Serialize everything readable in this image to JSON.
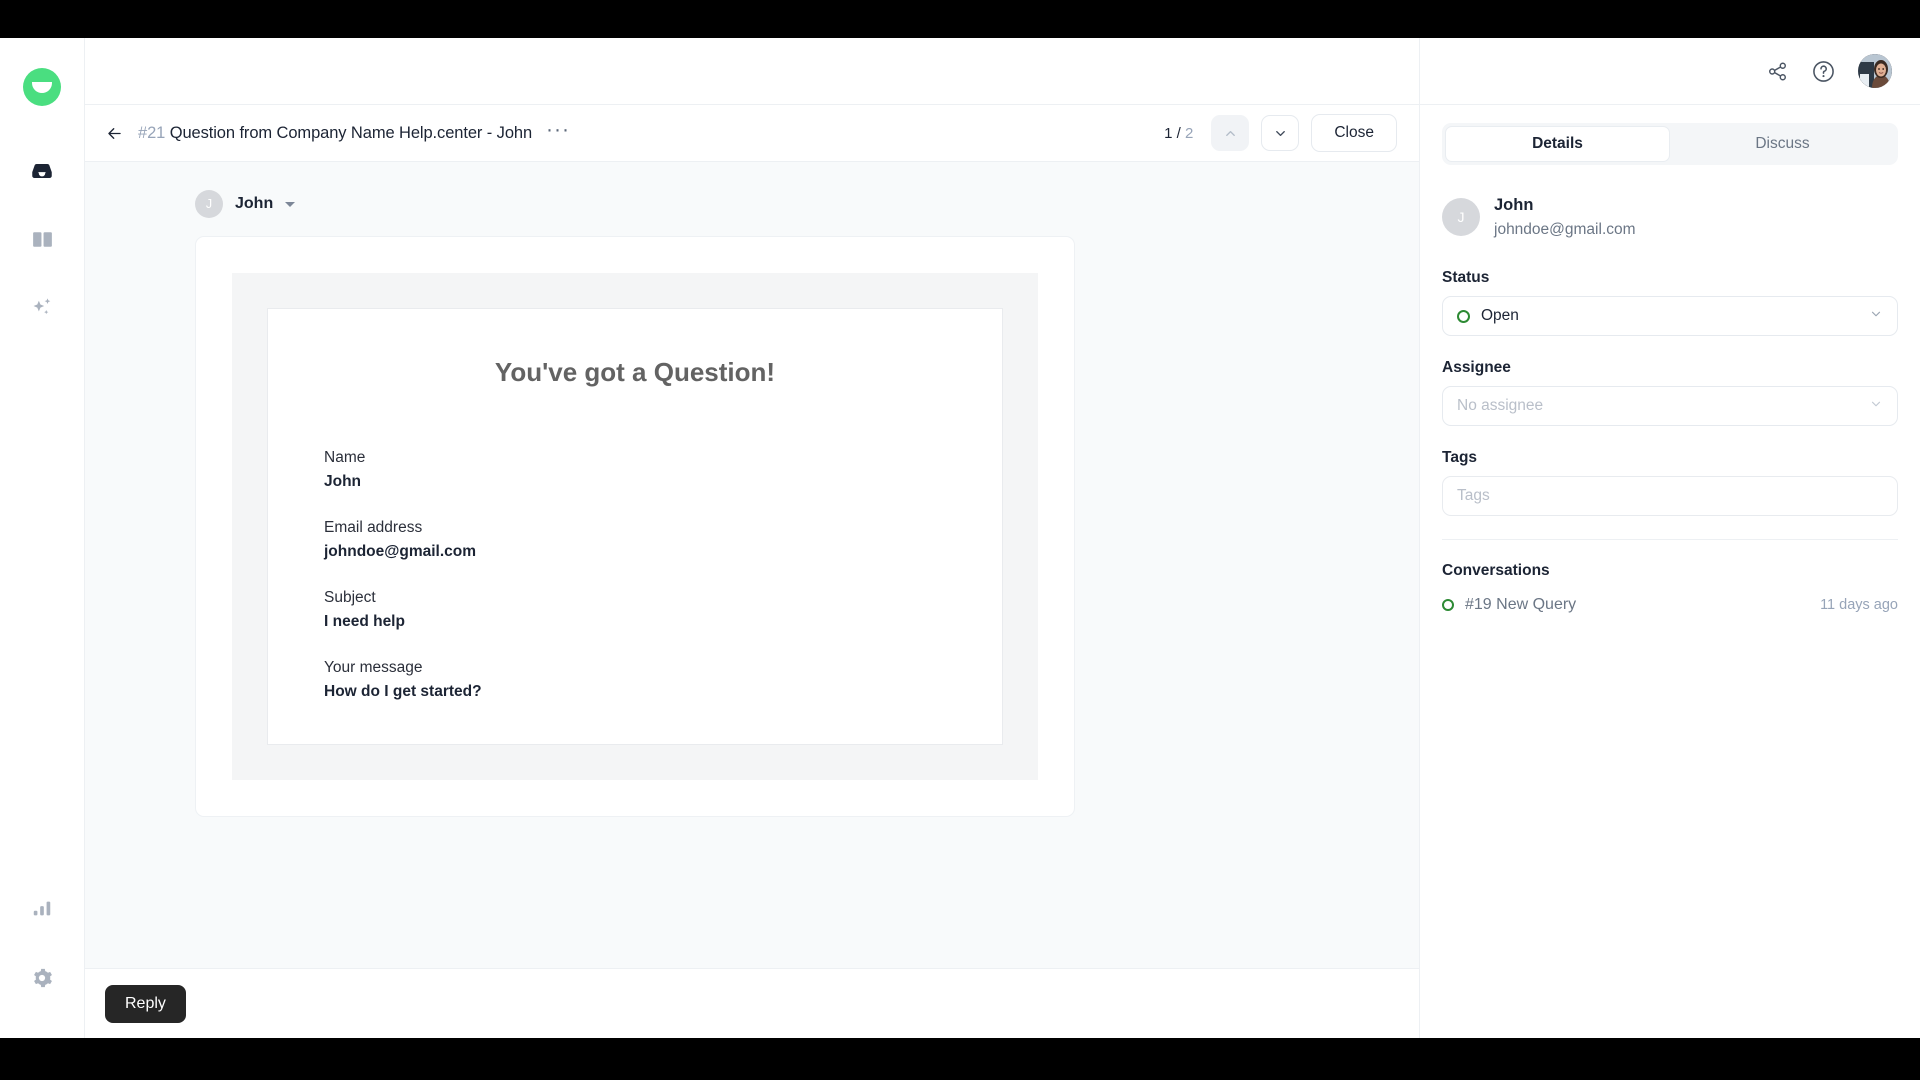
{
  "brand": {
    "logo_name": "helpcenter-logo",
    "accent": "#4ade80"
  },
  "rail": {
    "items": [
      {
        "name": "inbox",
        "icon": "inbox-icon",
        "active": true
      },
      {
        "name": "knowledge-base",
        "icon": "book-icon",
        "active": false
      },
      {
        "name": "ai-assist",
        "icon": "sparkles-icon",
        "active": false
      }
    ],
    "bottom_items": [
      {
        "name": "reports",
        "icon": "bar-chart-icon"
      },
      {
        "name": "settings",
        "icon": "gear-icon"
      }
    ]
  },
  "topbar": {
    "share_icon": "share-icon",
    "help_icon": "question-circle-icon",
    "avatar_name": "user-avatar"
  },
  "conversation": {
    "back_icon": "arrow-left-icon",
    "number": "#21",
    "title": "Question from Company Name Help.center - John",
    "more_label": "···",
    "page_current": "1",
    "page_separator": "/",
    "page_total": "2",
    "prev_icon": "chevron-up-icon",
    "next_icon": "chevron-down-icon",
    "close_label": "Close"
  },
  "message": {
    "author_initial": "J",
    "author": "John",
    "email_card": {
      "title": "You've got a Question!",
      "fields": [
        {
          "label": "Name",
          "value": "John"
        },
        {
          "label": "Email address",
          "value": "johndoe@gmail.com"
        },
        {
          "label": "Subject",
          "value": "I need help"
        },
        {
          "label": "Your message",
          "value": "How do I get started?"
        }
      ]
    }
  },
  "footer": {
    "reply_label": "Reply"
  },
  "details": {
    "tabs": [
      {
        "label": "Details",
        "active": true
      },
      {
        "label": "Discuss",
        "active": false
      }
    ],
    "contact": {
      "initial": "J",
      "name": "John",
      "email": "johndoe@gmail.com"
    },
    "status": {
      "label": "Status",
      "value": "Open",
      "color": "#2d8a34"
    },
    "assignee": {
      "label": "Assignee",
      "placeholder": "No assignee"
    },
    "tags": {
      "label": "Tags",
      "placeholder": "Tags",
      "value": ""
    },
    "conversations": {
      "label": "Conversations",
      "items": [
        {
          "id": "#19",
          "title": "#19 New Query",
          "time": "11 days ago",
          "status_color": "#2d8a34"
        }
      ]
    }
  }
}
